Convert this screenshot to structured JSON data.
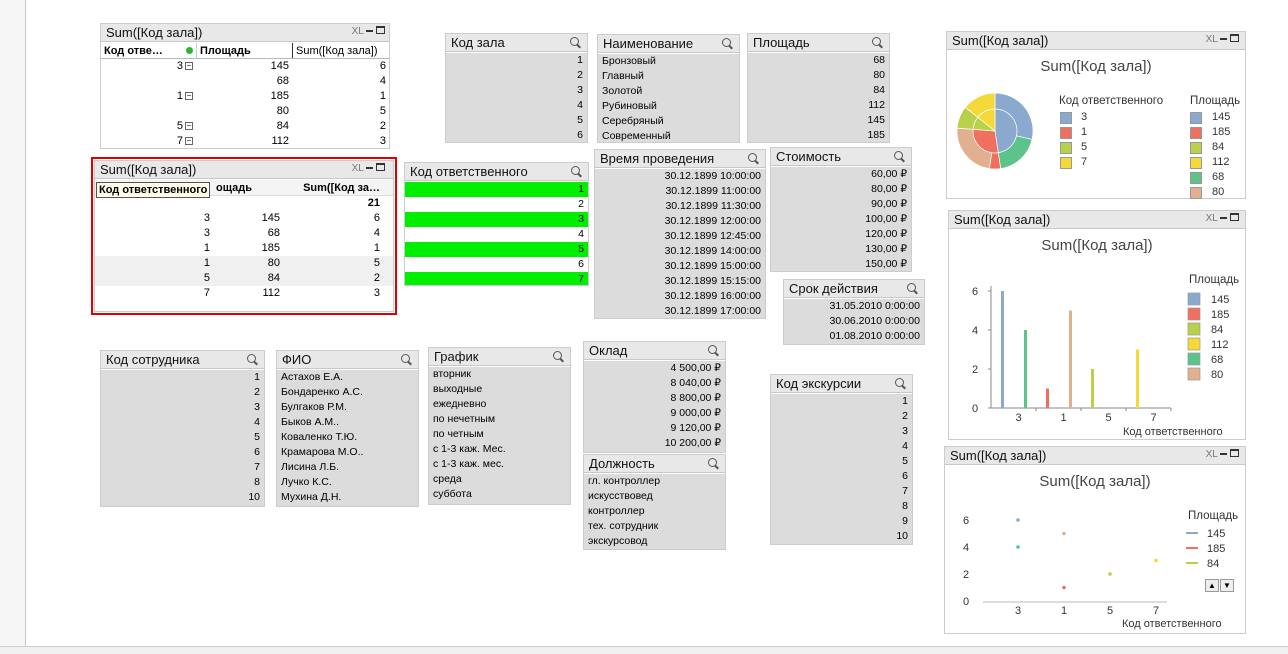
{
  "t1": {
    "title": "Sum([Код зала])",
    "xl": "XL",
    "headers": [
      "Код отве…",
      "Площадь",
      "Sum([Код зала])"
    ],
    "rows": [
      [
        "3",
        "145",
        "6"
      ],
      [
        "",
        "68",
        "4"
      ],
      [
        "1",
        "185",
        "1"
      ],
      [
        "",
        "80",
        "5"
      ],
      [
        "5",
        "84",
        "2"
      ],
      [
        "7",
        "112",
        "3"
      ]
    ]
  },
  "t2": {
    "title": "Sum([Код зала])",
    "xl": "XL",
    "headers": [
      "Код ответственного",
      "ощадь",
      "Sum([Код за…"
    ],
    "total": "21",
    "rows": [
      [
        "3",
        "145",
        "6"
      ],
      [
        "3",
        "68",
        "4"
      ],
      [
        "1",
        "185",
        "1"
      ],
      [
        "1",
        "80",
        "5"
      ],
      [
        "5",
        "84",
        "2"
      ],
      [
        "7",
        "112",
        "3"
      ]
    ]
  },
  "lb_kod_zala": {
    "title": "Код зала",
    "items": [
      "1",
      "2",
      "3",
      "4",
      "5",
      "6"
    ]
  },
  "lb_naim": {
    "title": "Наименование",
    "items": [
      "Бронзовый",
      "Главный",
      "Золотой",
      "Рубиновый",
      "Серебряный",
      "Современный"
    ]
  },
  "lb_plosh": {
    "title": "Площадь",
    "items": [
      "68",
      "80",
      "84",
      "112",
      "145",
      "185"
    ]
  },
  "lb_kod_otv": {
    "title": "Код ответственного",
    "items": [
      "1",
      "2",
      "3",
      "4",
      "5",
      "6",
      "7"
    ]
  },
  "lb_vremya": {
    "title": "Время проведения",
    "items": [
      "30.12.1899 10:00:00",
      "30.12.1899 11:00:00",
      "30.12.1899 11:30:00",
      "30.12.1899 12:00:00",
      "30.12.1899 12:45:00",
      "30.12.1899 14:00:00",
      "30.12.1899 15:00:00",
      "30.12.1899 15:15:00",
      "30.12.1899 16:00:00",
      "30.12.1899 17:00:00"
    ]
  },
  "lb_stoim": {
    "title": "Стоимость",
    "items": [
      "60,00 ₽",
      "80,00 ₽",
      "90,00 ₽",
      "100,00 ₽",
      "120,00 ₽",
      "130,00 ₽",
      "150,00 ₽"
    ]
  },
  "lb_srok": {
    "title": "Срок действия",
    "items": [
      "31.05.2010 0:00:00",
      "30.06.2010 0:00:00",
      "01.08.2010 0:00:00"
    ]
  },
  "lb_kod_sotr": {
    "title": "Код сотрудника",
    "items": [
      "1",
      "2",
      "3",
      "4",
      "5",
      "6",
      "7",
      "8",
      "10"
    ]
  },
  "lb_fio": {
    "title": "ФИО",
    "items": [
      "Астахов Е.А.",
      "Бондаренко А.С.",
      "Булгаков Р.М.",
      "Быков А.М..",
      "Коваленко Т.Ю.",
      "Крамарова М.О..",
      "Лисина Л.Б.",
      "Лучко К.С.",
      "Мухина Д.Н."
    ]
  },
  "lb_grafik": {
    "title": "График",
    "items": [
      "вторник",
      "выходные",
      "ежедневно",
      "по нечетным",
      "по четным",
      "с 1-3 каж. Мес.",
      "с 1-3 каж. мес.",
      "среда",
      "суббота"
    ]
  },
  "lb_oklad": {
    "title": "Оклад",
    "items": [
      "4 500,00 ₽",
      "8 040,00 ₽",
      "8 800,00 ₽",
      "9 000,00 ₽",
      "9 120,00 ₽",
      "10 200,00 ₽"
    ]
  },
  "lb_dolzh": {
    "title": "Должность",
    "items": [
      "гл. контроллер",
      "искусствовед",
      "контроллер",
      "тех. сотрудник",
      "экскурсовод"
    ]
  },
  "lb_kod_eks": {
    "title": "Код экскурсии",
    "items": [
      "1",
      "2",
      "3",
      "4",
      "5",
      "6",
      "7",
      "8",
      "9",
      "10"
    ]
  },
  "pie": {
    "caption": "Sum([Код зала])",
    "xl": "XL",
    "title": "Sum([Код зала])",
    "legend1_title": "Код ответственного",
    "legend1": [
      "3",
      "1",
      "5",
      "7"
    ],
    "legend2_title": "Площадь",
    "legend2": [
      "145",
      "185",
      "84",
      "112",
      "68",
      "80"
    ]
  },
  "bar": {
    "caption": "Sum([Код зала])",
    "xl": "XL",
    "title": "Sum([Код зала])",
    "legend_title": "Площадь",
    "xlabel": "Код ответственного"
  },
  "scatter": {
    "caption": "Sum([Код зала])",
    "xl": "XL",
    "title": "Sum([Код зала])",
    "legend_title": "Площадь",
    "legend": [
      "145",
      "185",
      "84"
    ],
    "xlabel": "Код ответственного"
  },
  "colors": {
    "145": "#8aa9cf",
    "185": "#f07060",
    "84": "#b8d04a",
    "112": "#f5d83a",
    "68": "#5cc48a",
    "80": "#e0b090",
    "green": "#00ee00",
    "selection": "#e00000"
  },
  "chart_data": [
    {
      "type": "pie",
      "title": "Sum([Код зала])",
      "inner_ring": {
        "name": "Код ответственного",
        "categories": [
          "3",
          "1",
          "5",
          "7"
        ],
        "values": [
          10,
          6,
          2,
          3
        ]
      },
      "outer_ring": {
        "name": "Площадь",
        "slices": [
          {
            "parent": "3",
            "label": "145",
            "value": 6
          },
          {
            "parent": "3",
            "label": "68",
            "value": 4
          },
          {
            "parent": "1",
            "label": "185",
            "value": 1
          },
          {
            "parent": "1",
            "label": "80",
            "value": 5
          },
          {
            "parent": "5",
            "label": "84",
            "value": 2
          },
          {
            "parent": "7",
            "label": "112",
            "value": 3
          }
        ]
      }
    },
    {
      "type": "bar",
      "title": "Sum([Код зала])",
      "xlabel": "Код ответственного",
      "ylabel": "",
      "categories": [
        "3",
        "1",
        "5",
        "7"
      ],
      "ylim": [
        0,
        6
      ],
      "yticks": [
        0,
        2,
        4,
        6
      ],
      "series": [
        {
          "name": "145",
          "values": [
            6,
            null,
            null,
            null
          ]
        },
        {
          "name": "185",
          "values": [
            null,
            1,
            null,
            null
          ]
        },
        {
          "name": "84",
          "values": [
            null,
            null,
            2,
            null
          ]
        },
        {
          "name": "112",
          "values": [
            null,
            null,
            null,
            3
          ]
        },
        {
          "name": "68",
          "values": [
            4,
            null,
            null,
            null
          ]
        },
        {
          "name": "80",
          "values": [
            null,
            5,
            null,
            null
          ]
        }
      ]
    },
    {
      "type": "scatter",
      "title": "Sum([Код зала])",
      "xlabel": "Код ответственного",
      "ylabel": "",
      "categories": [
        "3",
        "1",
        "5",
        "7"
      ],
      "ylim": [
        0,
        6
      ],
      "yticks": [
        0,
        2,
        4,
        6
      ],
      "series": [
        {
          "name": "145",
          "values": [
            6,
            null,
            null,
            null
          ]
        },
        {
          "name": "185",
          "values": [
            null,
            1,
            null,
            null
          ]
        },
        {
          "name": "84",
          "values": [
            null,
            null,
            2,
            null
          ]
        },
        {
          "name": "112",
          "values": [
            null,
            null,
            null,
            3
          ]
        },
        {
          "name": "68",
          "values": [
            4,
            null,
            null,
            null
          ]
        },
        {
          "name": "80",
          "values": [
            null,
            5,
            null,
            null
          ]
        }
      ]
    }
  ]
}
